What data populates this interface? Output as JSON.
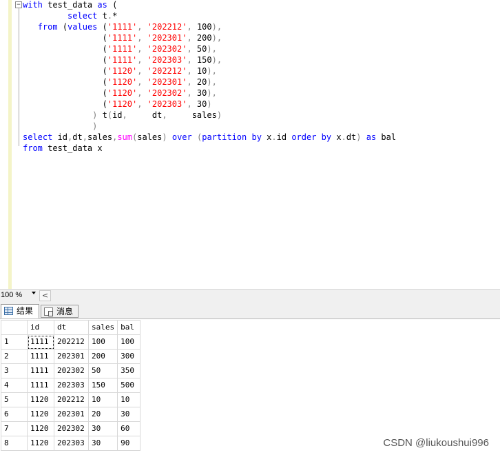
{
  "editor": {
    "lines": [
      [
        [
          "k",
          "with"
        ],
        [
          "t",
          " test_data "
        ],
        [
          "k",
          "as"
        ],
        [
          "t",
          " ("
        ]
      ],
      [
        [
          "t",
          "         "
        ],
        [
          "k",
          "select"
        ],
        [
          "t",
          " t"
        ],
        [
          "g",
          "."
        ],
        [
          "t",
          "*"
        ]
      ],
      [
        [
          "t",
          "   "
        ],
        [
          "k",
          "from"
        ],
        [
          "t",
          " ("
        ],
        [
          "k",
          "values"
        ],
        [
          "t",
          " ("
        ],
        [
          "s",
          "'1111'"
        ],
        [
          "g",
          ","
        ],
        [
          "t",
          " "
        ],
        [
          "s",
          "'202212'"
        ],
        [
          "g",
          ","
        ],
        [
          "t",
          " 100"
        ],
        [
          "g",
          "),"
        ]
      ],
      [
        [
          "t",
          "                ("
        ],
        [
          "s",
          "'1111'"
        ],
        [
          "g",
          ","
        ],
        [
          "t",
          " "
        ],
        [
          "s",
          "'202301'"
        ],
        [
          "g",
          ","
        ],
        [
          "t",
          " 200"
        ],
        [
          "g",
          "),"
        ]
      ],
      [
        [
          "t",
          "                ("
        ],
        [
          "s",
          "'1111'"
        ],
        [
          "g",
          ","
        ],
        [
          "t",
          " "
        ],
        [
          "s",
          "'202302'"
        ],
        [
          "g",
          ","
        ],
        [
          "t",
          " 50"
        ],
        [
          "g",
          "),"
        ]
      ],
      [
        [
          "t",
          "                ("
        ],
        [
          "s",
          "'1111'"
        ],
        [
          "g",
          ","
        ],
        [
          "t",
          " "
        ],
        [
          "s",
          "'202303'"
        ],
        [
          "g",
          ","
        ],
        [
          "t",
          " 150"
        ],
        [
          "g",
          "),"
        ]
      ],
      [
        [
          "t",
          "                ("
        ],
        [
          "s",
          "'1120'"
        ],
        [
          "g",
          ","
        ],
        [
          "t",
          " "
        ],
        [
          "s",
          "'202212'"
        ],
        [
          "g",
          ","
        ],
        [
          "t",
          " 10"
        ],
        [
          "g",
          "),"
        ]
      ],
      [
        [
          "t",
          "                ("
        ],
        [
          "s",
          "'1120'"
        ],
        [
          "g",
          ","
        ],
        [
          "t",
          " "
        ],
        [
          "s",
          "'202301'"
        ],
        [
          "g",
          ","
        ],
        [
          "t",
          " 20"
        ],
        [
          "g",
          "),"
        ]
      ],
      [
        [
          "t",
          "                ("
        ],
        [
          "s",
          "'1120'"
        ],
        [
          "g",
          ","
        ],
        [
          "t",
          " "
        ],
        [
          "s",
          "'202302'"
        ],
        [
          "g",
          ","
        ],
        [
          "t",
          " 30"
        ],
        [
          "g",
          "),"
        ]
      ],
      [
        [
          "t",
          "                ("
        ],
        [
          "s",
          "'1120'"
        ],
        [
          "g",
          ","
        ],
        [
          "t",
          " "
        ],
        [
          "s",
          "'202303'"
        ],
        [
          "g",
          ","
        ],
        [
          "t",
          " 30"
        ],
        [
          "g",
          ")"
        ]
      ],
      [
        [
          "t",
          "              "
        ],
        [
          "g",
          ")"
        ],
        [
          "t",
          " t"
        ],
        [
          "g",
          "("
        ],
        [
          "t",
          "id"
        ],
        [
          "g",
          ","
        ],
        [
          "t",
          "     dt"
        ],
        [
          "g",
          ","
        ],
        [
          "t",
          "     sales"
        ],
        [
          "g",
          ")"
        ]
      ],
      [
        [
          "t",
          "              "
        ],
        [
          "g",
          ")"
        ]
      ],
      [
        [
          "k",
          "select"
        ],
        [
          "t",
          " id"
        ],
        [
          "g",
          ","
        ],
        [
          "t",
          "dt"
        ],
        [
          "g",
          ","
        ],
        [
          "t",
          "sales"
        ],
        [
          "g",
          ","
        ],
        [
          "f",
          "sum"
        ],
        [
          "g",
          "("
        ],
        [
          "t",
          "sales"
        ],
        [
          "g",
          ")"
        ],
        [
          "t",
          " "
        ],
        [
          "k",
          "over"
        ],
        [
          "t",
          " "
        ],
        [
          "g",
          "("
        ],
        [
          "k",
          "partition"
        ],
        [
          "t",
          " "
        ],
        [
          "k",
          "by"
        ],
        [
          "t",
          " x"
        ],
        [
          "g",
          "."
        ],
        [
          "t",
          "id "
        ],
        [
          "k",
          "order"
        ],
        [
          "t",
          " "
        ],
        [
          "k",
          "by"
        ],
        [
          "t",
          " x"
        ],
        [
          "g",
          "."
        ],
        [
          "t",
          "dt"
        ],
        [
          "g",
          ")"
        ],
        [
          "t",
          " "
        ],
        [
          "k",
          "as"
        ],
        [
          "t",
          " bal"
        ]
      ],
      [
        [
          "k",
          "from"
        ],
        [
          "t",
          " test_data x"
        ]
      ]
    ]
  },
  "status": {
    "zoom": "100 %",
    "scroll_left_glyph": "<"
  },
  "tabs": {
    "results_label": "结果",
    "messages_label": "消息"
  },
  "results": {
    "columns": [
      "id",
      "dt",
      "sales",
      "bal"
    ],
    "rows": [
      [
        "1",
        "1111",
        "202212",
        "100",
        "100"
      ],
      [
        "2",
        "1111",
        "202301",
        "200",
        "300"
      ],
      [
        "3",
        "1111",
        "202302",
        "50",
        "350"
      ],
      [
        "4",
        "1111",
        "202303",
        "150",
        "500"
      ],
      [
        "5",
        "1120",
        "202212",
        "10",
        "10"
      ],
      [
        "6",
        "1120",
        "202301",
        "20",
        "30"
      ],
      [
        "7",
        "1120",
        "202302",
        "30",
        "60"
      ],
      [
        "8",
        "1120",
        "202303",
        "30",
        "90"
      ]
    ]
  },
  "watermark": "CSDN @liukoushui996"
}
